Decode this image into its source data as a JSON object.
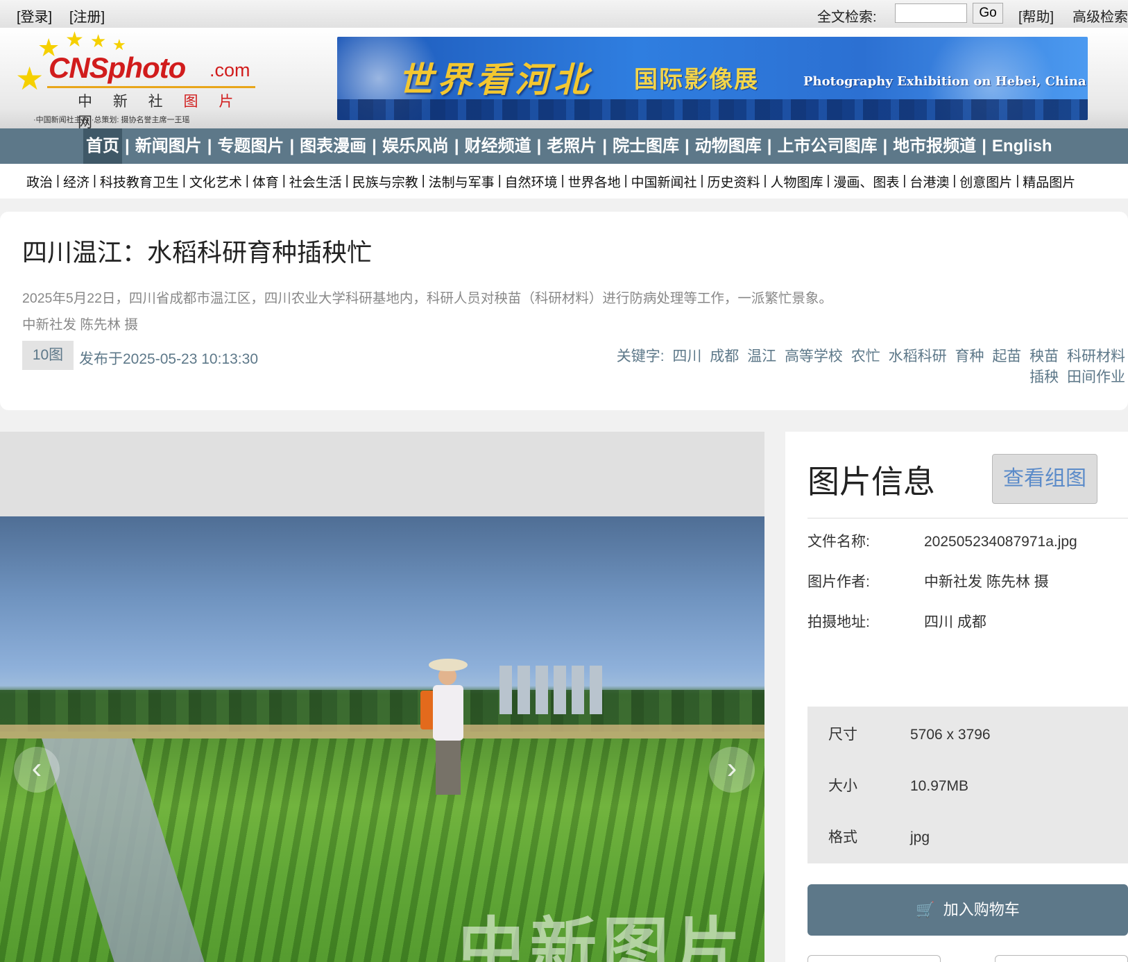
{
  "topbar": {
    "login": "[登录]",
    "register": "[注册]",
    "search_label": "全文检索:",
    "search_value": "",
    "go": "Go",
    "help": "[帮助]",
    "advanced": "高级检索"
  },
  "logo": {
    "brand": "CNSphoto",
    "suffix": ".com",
    "cn_name_a": "中 新 社",
    "cn_name_b": "图 片",
    "cn_name_c": "网",
    "tagline": "·中国新闻社主办  ·总策划: 摄协名誉主席一王瑶"
  },
  "banner": {
    "title": "世界看河北",
    "subtitle": "国际影像展",
    "english": "Photography Exhibition on Hebei, China"
  },
  "main_nav": [
    "首页",
    "新闻图片",
    "专题图片",
    "图表漫画",
    "娱乐风尚",
    "财经频道",
    "老照片",
    "院士图库",
    "动物图库",
    "上市公司图库",
    "地市报频道",
    "English"
  ],
  "sub_nav": [
    "政治",
    "经济",
    "科技教育卫生",
    "文化艺术",
    "体育",
    "社会生活",
    "民族与宗教",
    "法制与军事",
    "自然环境",
    "世界各地",
    "中国新闻社",
    "历史资料",
    "人物图库",
    "漫画、图表",
    "台港澳",
    "创意图片",
    "精品图片"
  ],
  "article": {
    "title": "四川温江：水稻科研育种插秧忙",
    "description": "2025年5月22日，四川省成都市温江区，四川农业大学科研基地内，科研人员对秧苗（科研材料）进行防病处理等工作，一派繁忙景象。",
    "credit": "中新社发 陈先林 摄",
    "count": "10图",
    "published": "发布于2025-05-23 10:13:30",
    "keywords_label": "关键字:",
    "keywords": [
      "四川",
      "成都",
      "温江",
      "高等学校",
      "农忙",
      "水稻科研",
      "育种",
      "起苗",
      "秧苗",
      "科研材料",
      "插秧",
      "田间作业"
    ]
  },
  "photo": {
    "watermark": "中新图片"
  },
  "info": {
    "heading": "图片信息",
    "view_group": "查看组图",
    "file_label": "文件名称:",
    "file_value": "202505234087971a.jpg",
    "author_label": "图片作者:",
    "author_value": "中新社发 陈先林 摄",
    "location_label": "拍摄地址:",
    "location_value": "四川 成都",
    "size_label": "尺寸",
    "size_value": "5706 x 3796",
    "bytes_label": "大小",
    "bytes_value": "10.97MB",
    "format_label": "格式",
    "format_value": "jpg",
    "cart": "加入购物车"
  },
  "colors": {
    "nav": "#5d7889",
    "brand_red": "#d11c1c",
    "link": "#5b8bc9"
  }
}
